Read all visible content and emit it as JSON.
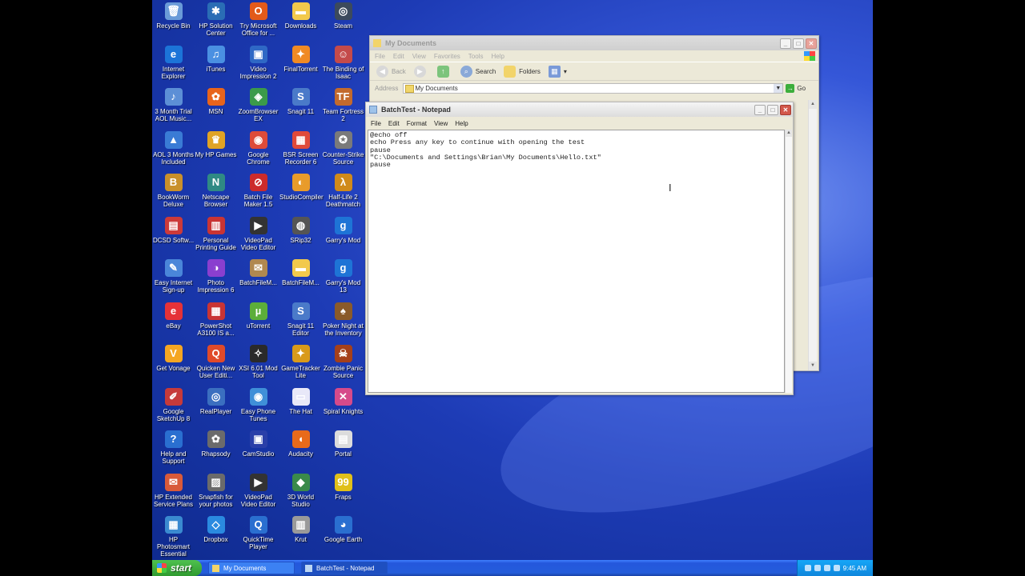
{
  "desktop_icons": [
    {
      "label": "Recycle Bin",
      "glyph": "🗑",
      "color": "#6a9bd8"
    },
    {
      "label": "HP Solution Center",
      "glyph": "✱",
      "color": "#2a6db5"
    },
    {
      "label": "Try Microsoft Office for ...",
      "glyph": "O",
      "color": "#e25a1a"
    },
    {
      "label": "Downloads",
      "glyph": "▬",
      "color": "#f2c94c"
    },
    {
      "label": "Steam",
      "glyph": "◎",
      "color": "#3c4a5c"
    },
    {
      "label": "Internet Explorer",
      "glyph": "e",
      "color": "#1c74d8"
    },
    {
      "label": "iTunes",
      "glyph": "♫",
      "color": "#4a90e2"
    },
    {
      "label": "Video Impression 2",
      "glyph": "▣",
      "color": "#2f68c5"
    },
    {
      "label": "FinalTorrent",
      "glyph": "✦",
      "color": "#f08a24"
    },
    {
      "label": "The Binding of Isaac",
      "glyph": "☺",
      "color": "#c44a4a"
    },
    {
      "label": "3 Month Trial AOL Music...",
      "glyph": "♪",
      "color": "#5c8fd6"
    },
    {
      "label": "MSN",
      "glyph": "✿",
      "color": "#e8641b"
    },
    {
      "label": "ZoomBrowser EX",
      "glyph": "◈",
      "color": "#3b9a4a"
    },
    {
      "label": "Snagit 11",
      "glyph": "S",
      "color": "#4a7ac9"
    },
    {
      "label": "Team Fortress 2",
      "glyph": "TF",
      "color": "#c36a2d"
    },
    {
      "label": "AOL 3 Months Included",
      "glyph": "▲",
      "color": "#3a7bd5"
    },
    {
      "label": "My HP Games",
      "glyph": "♛",
      "color": "#e0a324"
    },
    {
      "label": "Google Chrome",
      "glyph": "◉",
      "color": "#dd4b39"
    },
    {
      "label": "BSR Screen Recorder 6",
      "glyph": "▦",
      "color": "#e04a3a"
    },
    {
      "label": "Counter-Strike Source",
      "glyph": "✪",
      "color": "#7a7a7a"
    },
    {
      "label": "BookWorm Deluxe",
      "glyph": "B",
      "color": "#c9902b"
    },
    {
      "label": "Netscape Browser",
      "glyph": "N",
      "color": "#2f8a84"
    },
    {
      "label": "Batch File Maker 1.5",
      "glyph": "⊘",
      "color": "#cc2b2b"
    },
    {
      "label": "StudioCompiler",
      "glyph": "◐",
      "color": "#e89b2a"
    },
    {
      "label": "Half-Life 2 Deathmatch",
      "glyph": "λ",
      "color": "#d08a1a"
    },
    {
      "label": "DCSD Softw...",
      "glyph": "▤",
      "color": "#cc3a3a"
    },
    {
      "label": "Personal Printing Guide",
      "glyph": "▥",
      "color": "#c93434"
    },
    {
      "label": "VideoPad Video Editor",
      "glyph": "▶",
      "color": "#333333"
    },
    {
      "label": "SRip32",
      "glyph": "◍",
      "color": "#555555"
    },
    {
      "label": "Garry's Mod",
      "glyph": "g",
      "color": "#1e74d6"
    },
    {
      "label": "Easy Internet Sign-up",
      "glyph": "✎",
      "color": "#4a86d9"
    },
    {
      "label": "Photo Impression 6",
      "glyph": "◑",
      "color": "#8a3fcf"
    },
    {
      "label": "BatchFileM...",
      "glyph": "✉",
      "color": "#b08850"
    },
    {
      "label": "BatchFileM...",
      "glyph": "▬",
      "color": "#f2c94c"
    },
    {
      "label": "Garry's Mod 13",
      "glyph": "g",
      "color": "#1e74d6"
    },
    {
      "label": "eBay",
      "glyph": "e",
      "color": "#e53238"
    },
    {
      "label": "PowerShot A3100 IS a...",
      "glyph": "▦",
      "color": "#c93434"
    },
    {
      "label": "uTorrent",
      "glyph": "µ",
      "color": "#5cae3a"
    },
    {
      "label": "Snagit 11 Editor",
      "glyph": "S",
      "color": "#4a7ac9"
    },
    {
      "label": "Poker Night at the Inventory",
      "glyph": "♠",
      "color": "#8a5a2a"
    },
    {
      "label": "Get Vonage",
      "glyph": "V",
      "color": "#f5a623"
    },
    {
      "label": "Quicken New User Editi...",
      "glyph": "Q",
      "color": "#e04a2a"
    },
    {
      "label": "XSI 6.01 Mod Tool",
      "glyph": "✧",
      "color": "#2a2a2a"
    },
    {
      "label": "GameTracker Lite",
      "glyph": "✦",
      "color": "#d99a1a"
    },
    {
      "label": "Zombie Panic Source",
      "glyph": "☠",
      "color": "#a5401a"
    },
    {
      "label": "Google SketchUp 8",
      "glyph": "✐",
      "color": "#c63a3a"
    },
    {
      "label": "RealPlayer",
      "glyph": "◎",
      "color": "#3b6fc0"
    },
    {
      "label": "Easy Phone Tunes",
      "glyph": "◉",
      "color": "#3f8fd8"
    },
    {
      "label": "The Hat",
      "glyph": "▭",
      "color": "#e8e8f8"
    },
    {
      "label": "Spiral Knights",
      "glyph": "✕",
      "color": "#d64a8a"
    },
    {
      "label": "Help and Support",
      "glyph": "?",
      "color": "#2a6fd0"
    },
    {
      "label": "Rhapsody",
      "glyph": "✿",
      "color": "#6b6b6b"
    },
    {
      "label": "CamStudio",
      "glyph": "▣",
      "color": "#2a3fa8"
    },
    {
      "label": "Audacity",
      "glyph": "◖",
      "color": "#e86a1a"
    },
    {
      "label": "Portal",
      "glyph": "▤",
      "color": "#dcdcdc"
    },
    {
      "label": "HP Extended Service Plans",
      "glyph": "✉",
      "color": "#d85a3a"
    },
    {
      "label": "Snapfish for your photos",
      "glyph": "▨",
      "color": "#6b6b6b"
    },
    {
      "label": "VideoPad Video Editor",
      "glyph": "▶",
      "color": "#333333"
    },
    {
      "label": "3D World Studio",
      "glyph": "◆",
      "color": "#3a8a4a"
    },
    {
      "label": "Fraps",
      "glyph": "99",
      "color": "#e0c01a"
    },
    {
      "label": "HP Photosmart Essential",
      "glyph": "▦",
      "color": "#3a8ad0"
    },
    {
      "label": "Dropbox",
      "glyph": "◇",
      "color": "#2a8ae0"
    },
    {
      "label": "QuickTime Player",
      "glyph": "Q",
      "color": "#2a6fd0"
    },
    {
      "label": "Krut",
      "glyph": "▥",
      "color": "#9a9a9a"
    },
    {
      "label": "Google Earth",
      "glyph": "◕",
      "color": "#2a6fd0"
    }
  ],
  "mydocs": {
    "title": "My Documents",
    "menu": [
      "File",
      "Edit",
      "View",
      "Favorites",
      "Tools",
      "Help"
    ],
    "toolbar": {
      "back": "Back",
      "search": "Search",
      "folders": "Folders"
    },
    "address_label": "Address",
    "address_value": "My Documents",
    "go_label": "Go"
  },
  "notepad": {
    "title": "BatchTest - Notepad",
    "menu": [
      "File",
      "Edit",
      "Format",
      "View",
      "Help"
    ],
    "content": "@echo off\necho Press any key to continue with opening the test\npause\n\"C:\\Documents and Settings\\Brian\\My Documents\\Hello.txt\"\npause"
  },
  "taskbar": {
    "start_label": "start",
    "tasks": [
      {
        "label": "My Documents",
        "active": false
      },
      {
        "label": "BatchTest - Notepad",
        "active": true
      }
    ],
    "clock": "9:45 AM"
  }
}
